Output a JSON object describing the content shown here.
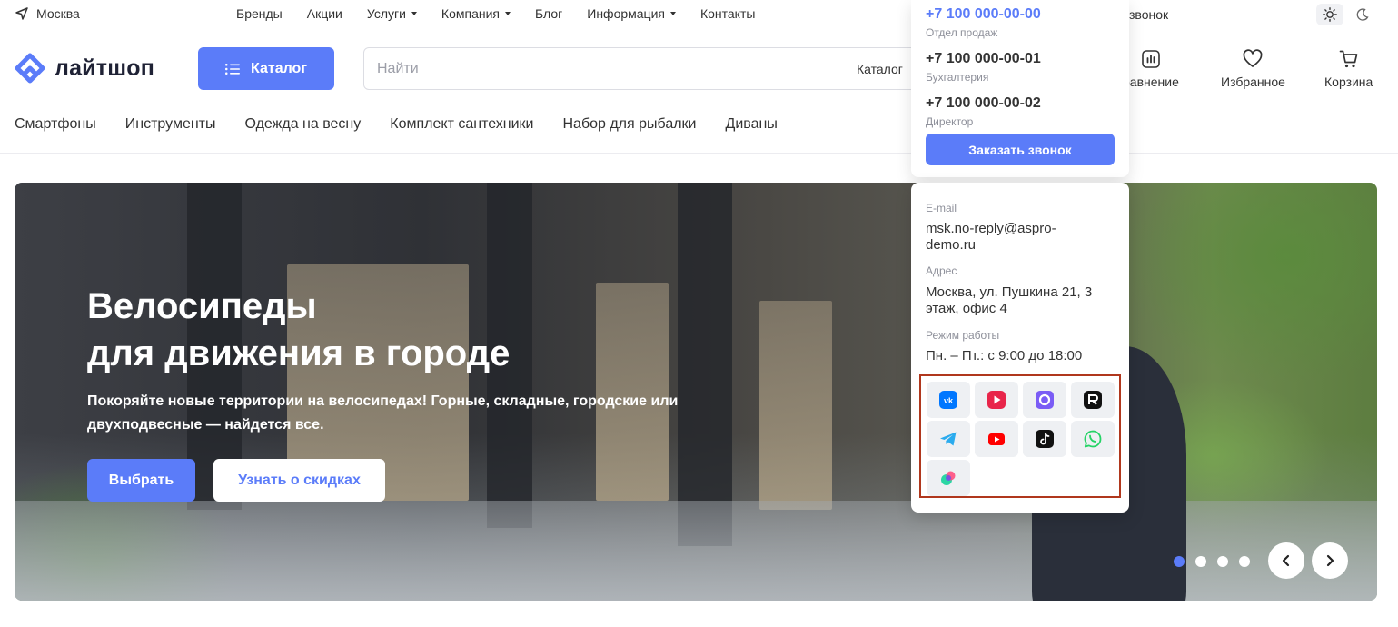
{
  "topbar": {
    "city": "Москва",
    "nav": [
      {
        "label": "Бренды",
        "has_dropdown": false
      },
      {
        "label": "Акции",
        "has_dropdown": false
      },
      {
        "label": "Услуги",
        "has_dropdown": true
      },
      {
        "label": "Компания",
        "has_dropdown": true
      },
      {
        "label": "Блог",
        "has_dropdown": false
      },
      {
        "label": "Информация",
        "has_dropdown": true
      },
      {
        "label": "Контакты",
        "has_dropdown": false
      }
    ],
    "call_partial": "звонок"
  },
  "header": {
    "logo_text": "лайтшоп",
    "catalog_label": "Каталог",
    "search": {
      "placeholder": "Найти",
      "scope": "Каталог"
    },
    "compare_partial": "равнение",
    "favorites_label": "Избранное",
    "cart_label": "Корзина"
  },
  "quicklinks": [
    "Смартфоны",
    "Инструменты",
    "Одежда на весну",
    "Комплект сантехники",
    "Набор для рыбалки",
    "Диваны"
  ],
  "hero": {
    "title_line1": "Велосипеды",
    "title_line2": "для движения в городе",
    "subtitle": "Покоряйте новые территории на велосипедах! Горные, складные, городские или двухподвесные — найдется все.",
    "btn_primary": "Выбрать",
    "btn_secondary": "Узнать о скидках",
    "slides_total": 4,
    "active_slide": 1
  },
  "phones_panel": {
    "phones": [
      {
        "number": "+7 100 000-00-00",
        "label": "Отдел продаж"
      },
      {
        "number": "+7 100 000-00-01",
        "label": "Бухгалтерия"
      },
      {
        "number": "+7 100 000-00-02",
        "label": "Директор"
      }
    ],
    "order_call_label": "Заказать звонок"
  },
  "info_panel": {
    "email_label": "E-mail",
    "email_line1": "msk.no-reply@aspro-",
    "email_line2": "demo.ru",
    "address_label": "Адрес",
    "address_line1": "Москва, ул. Пушкина 21, 3",
    "address_line2": "этаж, офис 4",
    "hours_label": "Режим работы",
    "hours_value": "Пн. – Пт.: с 9:00 до 18:00",
    "socials": [
      "vk-icon",
      "vk-video-icon",
      "max-messenger-icon",
      "rutube-icon",
      "telegram-icon",
      "youtube-icon",
      "tiktok-icon",
      "whatsapp-icon",
      "yandex-messenger-icon"
    ]
  },
  "colors": {
    "accent": "#5b7cf9",
    "highlight_border": "#b0371d",
    "text": "#333333",
    "muted": "#8e909a"
  }
}
